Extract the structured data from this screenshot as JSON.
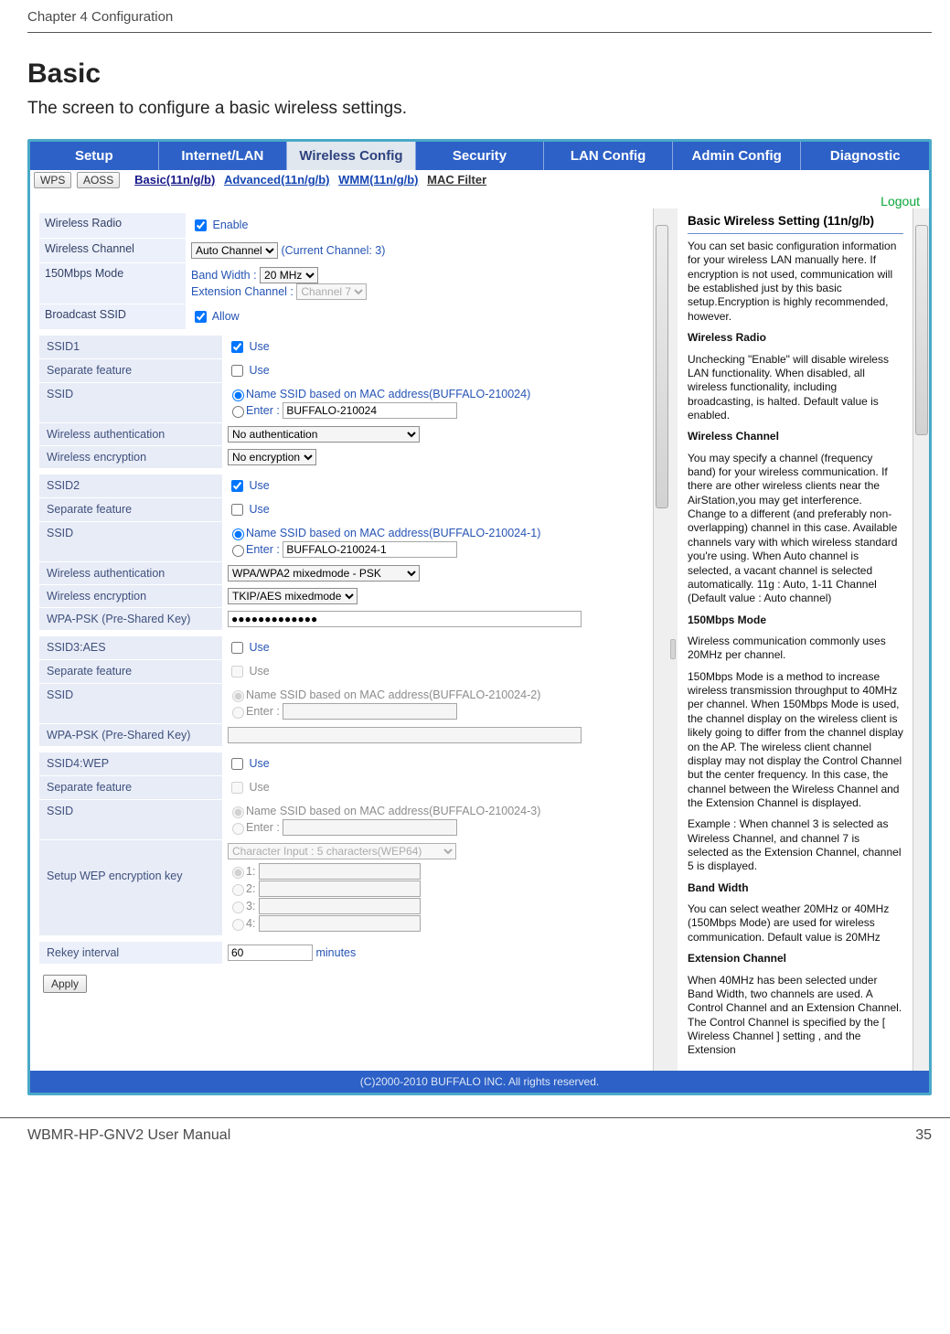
{
  "doc": {
    "chapter": "Chapter 4  Configuration",
    "section_title": "Basic",
    "section_desc": "The screen to configure a basic wireless settings.",
    "footer_left": "WBMR-HP-GNV2 User Manual",
    "footer_right": "35"
  },
  "topnav": [
    "Setup",
    "Internet/LAN",
    "Wireless Config",
    "Security",
    "LAN Config",
    "Admin Config",
    "Diagnostic"
  ],
  "subnav": {
    "btn1": "WPS",
    "btn2": "AOSS",
    "links": [
      "Basic(11n/g/b)",
      "Advanced(11n/g/b)",
      "WMM(11n/g/b)",
      "MAC Filter"
    ]
  },
  "logout": "Logout",
  "basic": {
    "wireless_radio_label": "Wireless Radio",
    "wireless_radio_enable": "Enable",
    "wireless_channel_label": "Wireless Channel",
    "wireless_channel_value": "Auto Channel",
    "wireless_channel_note": "(Current Channel: 3)",
    "mode150_label": "150Mbps Mode",
    "bandwidth_label": "Band Width : ",
    "bandwidth_value": "20 MHz",
    "ext_channel_label": "Extension Channel : ",
    "ext_channel_value": "Channel 7",
    "broadcast_label": "Broadcast SSID",
    "broadcast_allow": "Allow"
  },
  "ssid1": {
    "title": "SSID1",
    "use": "Use",
    "sep_label": "Separate feature",
    "ssid_label": "SSID",
    "radio_mac": "Name SSID based on MAC address(BUFFALO-210024)",
    "radio_enter": "Enter :",
    "ssid_value": "BUFFALO-210024",
    "auth_label": "Wireless authentication",
    "auth_value": "No authentication",
    "enc_label": "Wireless encryption",
    "enc_value": "No encryption"
  },
  "ssid2": {
    "title": "SSID2",
    "use": "Use",
    "sep_label": "Separate feature",
    "ssid_label": "SSID",
    "radio_mac": "Name SSID based on MAC address(BUFFALO-210024-1)",
    "radio_enter": "Enter :",
    "ssid_value": "BUFFALO-210024-1",
    "auth_label": "Wireless authentication",
    "auth_value": "WPA/WPA2 mixedmode - PSK",
    "enc_label": "Wireless encryption",
    "enc_value": "TKIP/AES mixedmode",
    "psk_label": "WPA-PSK (Pre-Shared Key)",
    "psk_value": "●●●●●●●●●●●●●"
  },
  "ssid3": {
    "title": "SSID3:AES",
    "use": "Use",
    "sep_label": "Separate feature",
    "ssid_label": "SSID",
    "radio_mac": "Name SSID based on MAC address(BUFFALO-210024-2)",
    "radio_enter": "Enter :",
    "ssid_value": "",
    "psk_label": "WPA-PSK (Pre-Shared Key)",
    "psk_value": ""
  },
  "ssid4": {
    "title": "SSID4:WEP",
    "use": "Use",
    "sep_label": "Separate feature",
    "ssid_label": "SSID",
    "radio_mac": "Name SSID based on MAC address(BUFFALO-210024-3)",
    "radio_enter": "Enter :",
    "ssid_value": "",
    "wep_label": "Setup WEP encryption key",
    "wep_select": "Character Input  :  5 characters(WEP64)",
    "wep_1": "1:",
    "wep_2": "2:",
    "wep_3": "3:",
    "wep_4": "4:"
  },
  "rekey": {
    "label": "Rekey interval",
    "value": "60",
    "unit": "minutes"
  },
  "apply": "Apply",
  "copyright": "(C)2000-2010 BUFFALO INC. All rights reserved.",
  "help": {
    "title": "Basic Wireless Setting (11n/g/b)",
    "p1": "You can set basic configuration information for your wireless LAN manually here. If encryption is not used, communication will be established just by this basic setup.Encryption is highly recommended, however.",
    "h_radio": "Wireless Radio",
    "p_radio": "Unchecking \"Enable\" will disable wireless LAN functionality. When disabled, all wireless functionality, including broadcasting, is halted. Default value is enabled.",
    "h_channel": "Wireless Channel",
    "p_channel": "You may specify a channel (frequency band) for your wireless communication. If there are other wireless clients near the AirStation,you may get interference. Change to a different (and preferably non-overlapping) channel in this case. Available channels vary with which wireless standard you're using. When Auto channel is selected, a vacant channel is selected automatically. 11g : Auto, 1-11 Channel (Default value : Auto channel)",
    "h_150": "150Mbps Mode",
    "p_150a": "Wireless communication commonly uses 20MHz per channel.",
    "p_150b": "150Mbps Mode is a method to increase wireless transmission throughput to 40MHz per channel. When 150Mbps Mode is used, the channel display on the wireless client is likely going to differ from the channel display on the AP. The wireless client channel display may not display the Control Channel but the center frequency. In this case, the channel between the Wireless Channel and the Extension Channel is displayed.",
    "p_150c": "Example : When channel 3 is selected as Wireless Channel, and channel 7 is selected as the Extension Channel, channel 5 is displayed.",
    "h_bw": "Band Width",
    "p_bw": "You can select weather 20MHz or 40MHz (150Mbps Mode) are used for wireless communication. Default value is 20MHz",
    "h_ext": "Extension Channel",
    "p_ext": "When 40MHz has been selected under Band Width, two channels are used. A Control Channel and an Extension Channel. The Control Channel is specified by the [ Wireless Channel ] setting , and the Extension"
  }
}
